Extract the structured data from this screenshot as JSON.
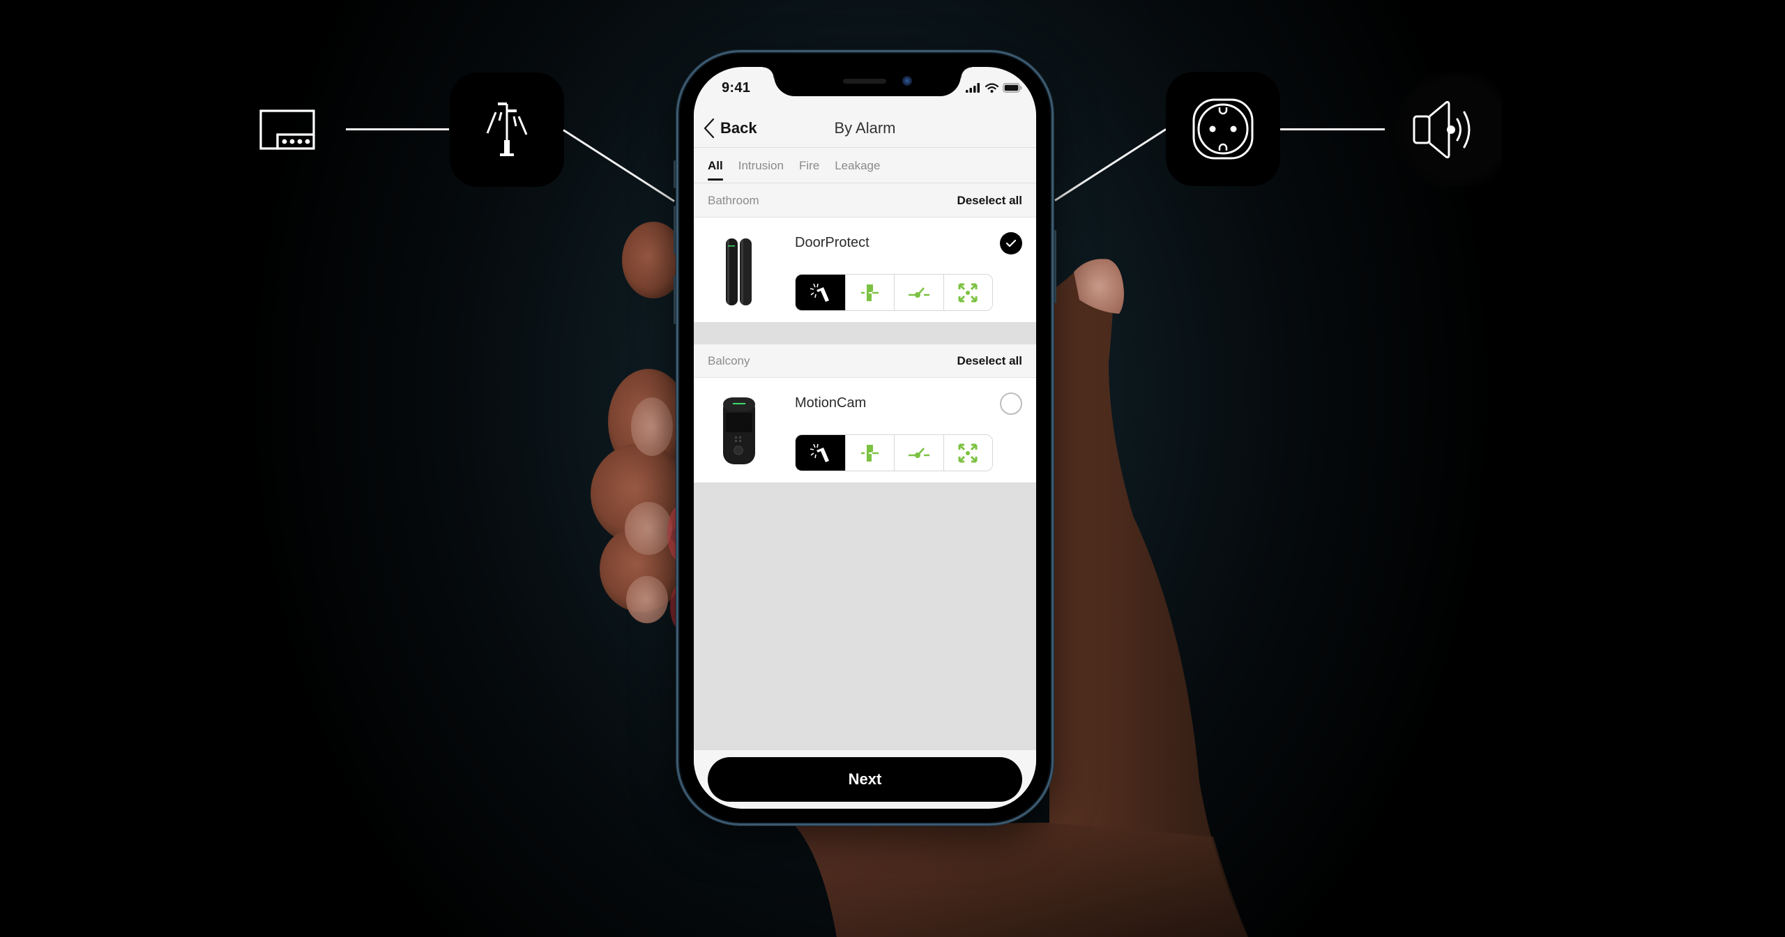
{
  "features": {
    "left": [
      {
        "name": "keypad",
        "icon": "keypad-icon"
      },
      {
        "name": "siren-street-light",
        "icon": "street-light-icon"
      }
    ],
    "right": [
      {
        "name": "socket",
        "icon": "socket-icon"
      },
      {
        "name": "speaker",
        "icon": "speaker-icon"
      }
    ]
  },
  "status_bar": {
    "time": "9:41",
    "icons": [
      "signal-icon",
      "wifi-icon",
      "battery-icon"
    ]
  },
  "nav": {
    "back_label": "Back",
    "title": "By Alarm"
  },
  "tabs": [
    {
      "label": "All",
      "active": true
    },
    {
      "label": "Intrusion",
      "active": false
    },
    {
      "label": "Fire",
      "active": false
    },
    {
      "label": "Leakage",
      "active": false
    }
  ],
  "sections": [
    {
      "room": "Bathroom",
      "action_label": "Deselect all",
      "device": {
        "name": "DoorProtect",
        "selected": true,
        "image": "door-sensor-image",
        "alarm_types": [
          {
            "icon": "tamper-alarm-icon",
            "active": true
          },
          {
            "icon": "door-opening-icon",
            "active": false
          },
          {
            "icon": "switch-contact-icon",
            "active": false
          },
          {
            "icon": "motion-area-icon",
            "active": false
          }
        ]
      }
    },
    {
      "room": "Balcony",
      "action_label": "Deselect all",
      "device": {
        "name": "MotionCam",
        "selected": false,
        "image": "motion-camera-image",
        "alarm_types": [
          {
            "icon": "tamper-alarm-icon",
            "active": true
          },
          {
            "icon": "door-opening-icon",
            "active": false
          },
          {
            "icon": "switch-contact-icon",
            "active": false
          },
          {
            "icon": "motion-area-icon",
            "active": false
          }
        ]
      }
    }
  ],
  "footer": {
    "next_label": "Next"
  },
  "colors": {
    "accent_green": "#7cc242",
    "primary_black": "#000000",
    "screen_bg": "#f5f5f5",
    "list_gap_bg": "#dfdfdf"
  }
}
